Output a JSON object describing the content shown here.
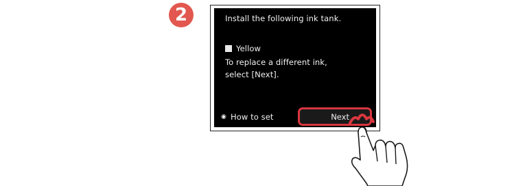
{
  "step": {
    "number": "2"
  },
  "screen": {
    "line1": "Install the following ink tank.",
    "ink_color": "Yellow",
    "line2": "To replace a different ink,",
    "line3": "select [Next].",
    "howto_label": "How to set",
    "next_label": "Next"
  },
  "colors": {
    "badge": "#e2574f",
    "highlight": "#d9363e",
    "screen_bg": "#000000"
  },
  "icons": [
    "numbered-step-icon",
    "howto-icon",
    "hand-pointer-icon",
    "tap-indicator-icon"
  ]
}
